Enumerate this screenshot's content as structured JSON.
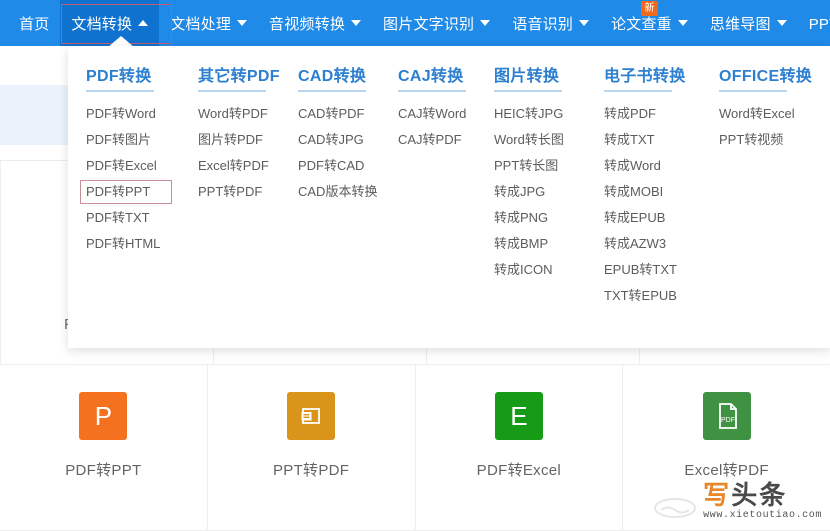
{
  "navbar": {
    "background_color": "#1f8ae8",
    "active_background_color": "#0f72cf",
    "highlight_box_color": "#c45b6e",
    "items": [
      {
        "label": "首页",
        "caret": "",
        "active": false,
        "badge": ""
      },
      {
        "label": "文档转换",
        "caret": "up",
        "active": true,
        "badge": ""
      },
      {
        "label": "文档处理",
        "caret": "down",
        "active": false,
        "badge": ""
      },
      {
        "label": "音视频转换",
        "caret": "down",
        "active": false,
        "badge": ""
      },
      {
        "label": "图片文字识别",
        "caret": "down",
        "active": false,
        "badge": ""
      },
      {
        "label": "语音识别",
        "caret": "down",
        "active": false,
        "badge": ""
      },
      {
        "label": "论文查重",
        "caret": "down",
        "active": false,
        "badge": "新"
      },
      {
        "label": "思维导图",
        "caret": "down",
        "active": false,
        "badge": ""
      },
      {
        "label": "PPT模",
        "caret": "",
        "active": false,
        "badge": ""
      }
    ]
  },
  "megamenu": {
    "heading_color": "#2d7fd0",
    "selected_item": "PDF转PPT",
    "columns": [
      {
        "title": "PDF转换",
        "links": [
          "PDF转Word",
          "PDF转图片",
          "PDF转Excel",
          "PDF转PPT",
          "PDF转TXT",
          "PDF转HTML"
        ]
      },
      {
        "title": "其它转PDF",
        "links": [
          "Word转PDF",
          "图片转PDF",
          "Excel转PDF",
          "PPT转PDF"
        ]
      },
      {
        "title": "CAD转换",
        "links": [
          "CAD转PDF",
          "CAD转JPG",
          "PDF转CAD",
          "CAD版本转换"
        ]
      },
      {
        "title": "CAJ转换",
        "links": [
          "CAJ转Word",
          "CAJ转PDF"
        ]
      },
      {
        "title": "图片转换",
        "links": [
          "HEIC转JPG",
          "Word转长图",
          "PPT转长图",
          "转成JPG",
          "转成PNG",
          "转成BMP",
          "转成ICON"
        ]
      },
      {
        "title": "电子书转换",
        "links": [
          "转成PDF",
          "转成TXT",
          "转成Word",
          "转成MOBI",
          "转成EPUB",
          "转成AZW3",
          "EPUB转TXT",
          "TXT转EPUB"
        ]
      },
      {
        "title": "OFFICE转换",
        "links": [
          "Word转Excel",
          "PPT转视频"
        ]
      }
    ]
  },
  "cards": [
    {
      "label": "PDF转PPT",
      "icon_glyph": "P",
      "icon_color": "#f4711f",
      "icon_name": "powerpoint-file-icon"
    },
    {
      "label": "PPT转PDF",
      "icon_glyph": "",
      "icon_color": "#d9941a",
      "icon_name": "ppt-to-pdf-icon"
    },
    {
      "label": "PDF转Excel",
      "icon_glyph": "E",
      "icon_color": "#169b16",
      "icon_name": "excel-file-icon"
    },
    {
      "label": "Excel转PDF",
      "icon_glyph": "PDF",
      "icon_color": "#3f9242",
      "icon_name": "pdf-document-icon"
    }
  ],
  "background": {
    "ghost_card_label": "P"
  },
  "watermark": {
    "title_part1": "写",
    "title_part2": "头条",
    "url": "www.xietoutiao.com"
  }
}
